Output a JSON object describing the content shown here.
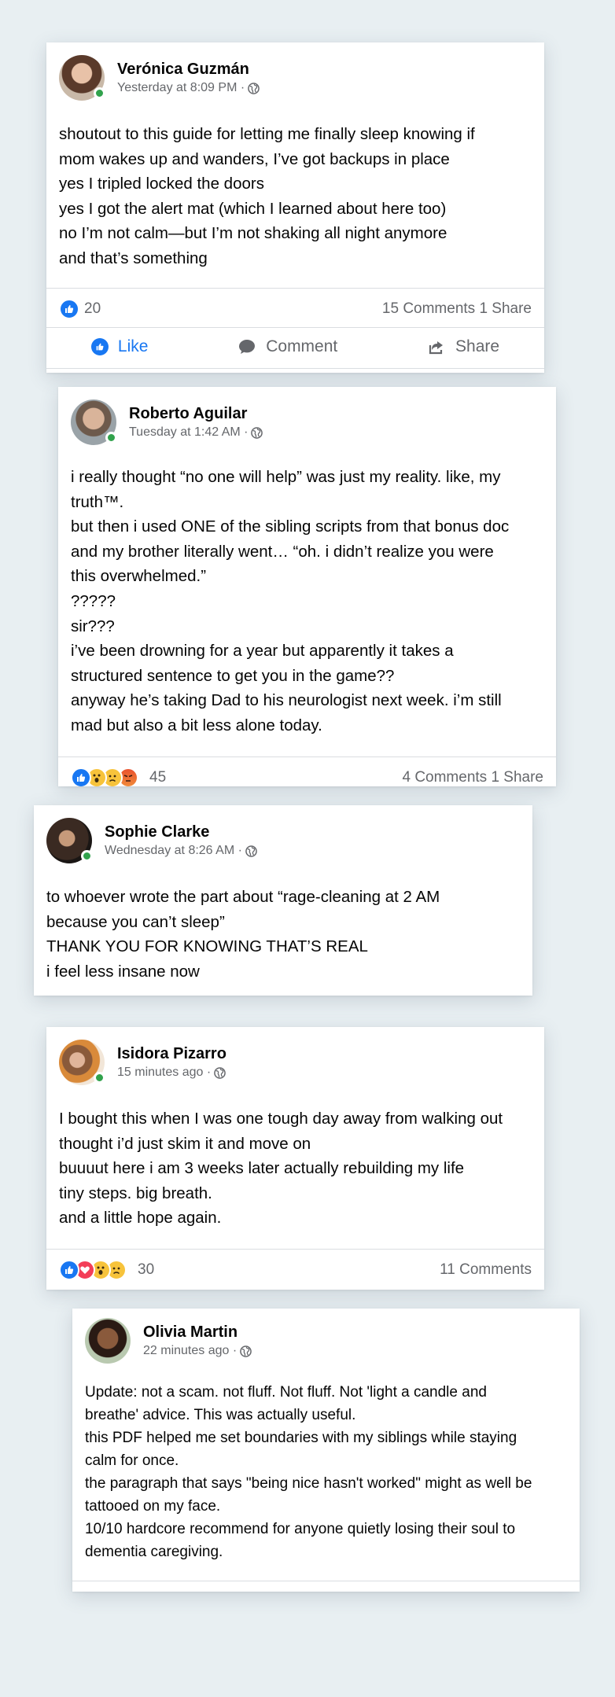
{
  "posts": [
    {
      "name": "Verónica Guzmán",
      "time": "Yesterday at 8:09 PM ·",
      "lines": [
        "shoutout to this guide for letting me finally sleep knowing if",
        "mom wakes up and wanders, I’ve got backups in place",
        "yes I tripled locked the doors",
        "yes I got the alert mat (which I learned about here too)",
        "no I’m not calm—but I’m not shaking all night anymore",
        "and that’s something"
      ],
      "reaction_count": "20",
      "stats_right": "15 Comments 1 Share",
      "actions": {
        "like": "Like",
        "comment": "Comment",
        "share": "Share"
      }
    },
    {
      "name": "Roberto Aguilar",
      "time": "Tuesday at 1:42 AM ·",
      "lines": [
        "i really thought “no one will help” was just my reality. like, my",
        "truth™.",
        "but then i used ONE of the sibling scripts from that bonus doc",
        "and my brother literally went… “oh. i didn’t realize you were",
        "this overwhelmed.”",
        "?????",
        "sir???",
        "i’ve been drowning for a year but apparently it takes a",
        "structured sentence to get you in the game??",
        "anyway he’s taking Dad to his neurologist next week. i’m still",
        "mad but also a bit less alone today."
      ],
      "reaction_count": "45",
      "stats_right": "4 Comments 1 Share"
    },
    {
      "name": "Sophie Clarke",
      "time": "Wednesday at 8:26 AM ·",
      "lines": [
        "to whoever wrote the part about “rage-cleaning at 2 AM",
        "because you can’t sleep”",
        "THANK YOU FOR KNOWING THAT’S REAL",
        "i feel less insane now"
      ]
    },
    {
      "name": "Isidora Pizarro",
      "time": "15 minutes ago ·",
      "lines": [
        "I bought this when I was one tough day away from walking out",
        "thought i’d just skim it and move on",
        "buuuut here i am 3 weeks later actually rebuilding my life",
        "tiny steps. big breath.",
        "and a little hope again."
      ],
      "reaction_count": "30",
      "stats_right": "11 Comments"
    },
    {
      "name": "Olivia Martin",
      "time": "22 minutes ago ·",
      "lines": [
        "Update: not a scam. not fluff. Not fluff. Not 'light a candle and",
        "breathe' advice. This was actually useful.",
        "this PDF helped me set boundaries with my siblings while staying",
        "calm for once.",
        "the paragraph that says \"being nice hasn't worked\" might as well be",
        "tattooed on my face.",
        "10/10 hardcore recommend for anyone quietly losing their soul to",
        "dementia caregiving."
      ]
    }
  ],
  "colors": {
    "like_blue": "#1877f2",
    "online_green": "#31a24c",
    "muted_text": "#65676b",
    "background": "#e8eff2"
  },
  "icons": [
    "globe-icon",
    "like-reaction-icon",
    "wow-reaction-icon",
    "sad-reaction-icon",
    "angry-reaction-icon",
    "love-reaction-icon",
    "comment-icon",
    "share-icon"
  ]
}
